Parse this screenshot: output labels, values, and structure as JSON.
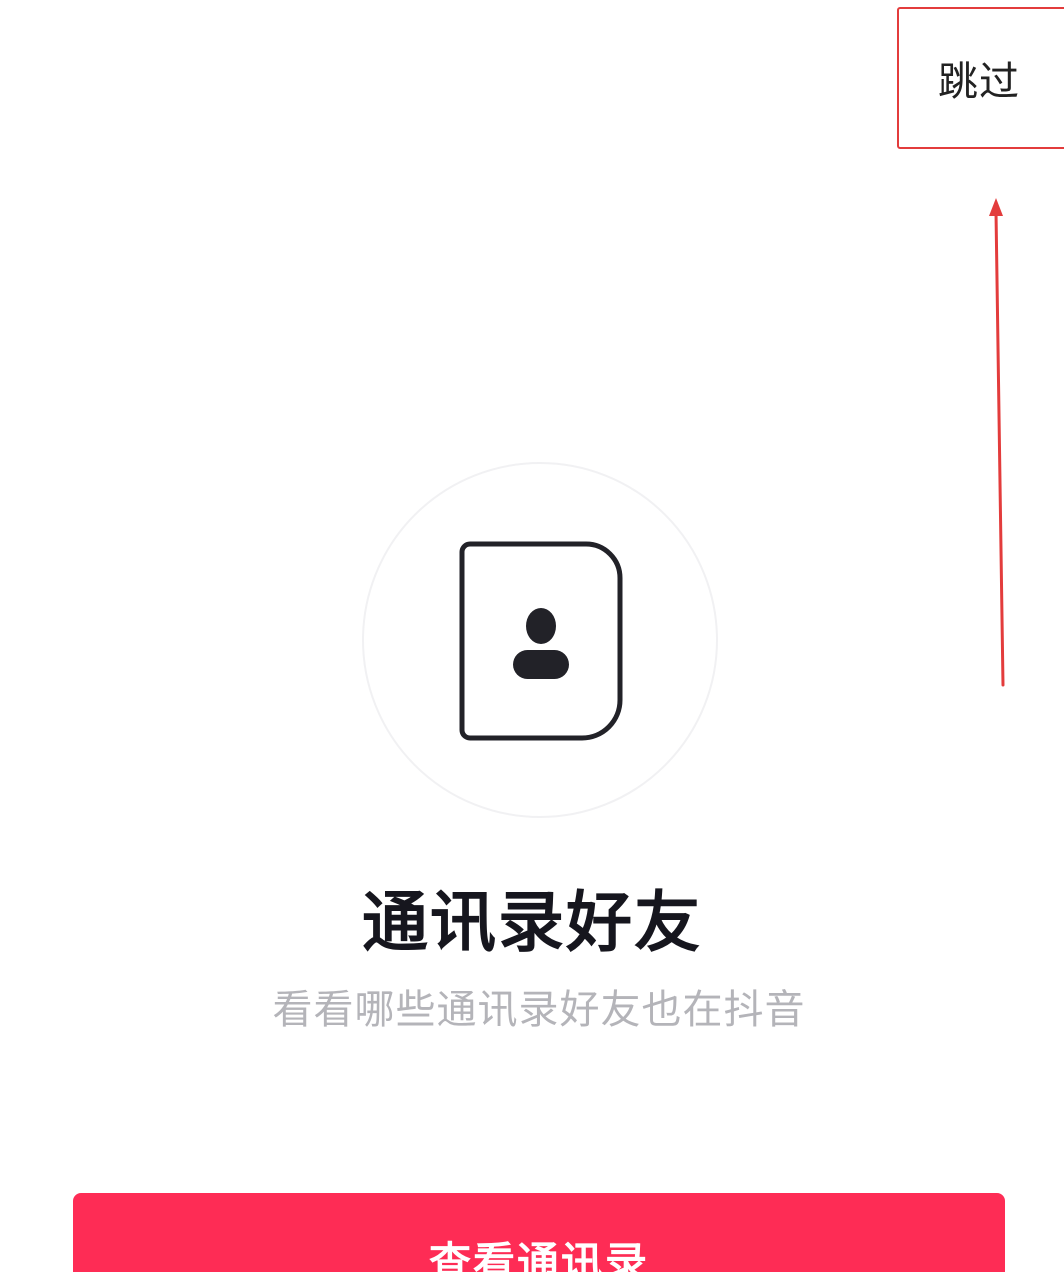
{
  "header": {
    "skip_label": "跳过"
  },
  "main": {
    "title": "通讯录好友",
    "subtitle": "看看哪些通讯录好友也在抖音",
    "illustration_icon": "contact-card-icon"
  },
  "footer": {
    "primary_button_label": "查看通讯录"
  },
  "colors": {
    "primary": "#fe2c55",
    "title_text": "#16161e",
    "subtitle_text": "#b4b4b9",
    "annotation": "#e33c3c"
  }
}
